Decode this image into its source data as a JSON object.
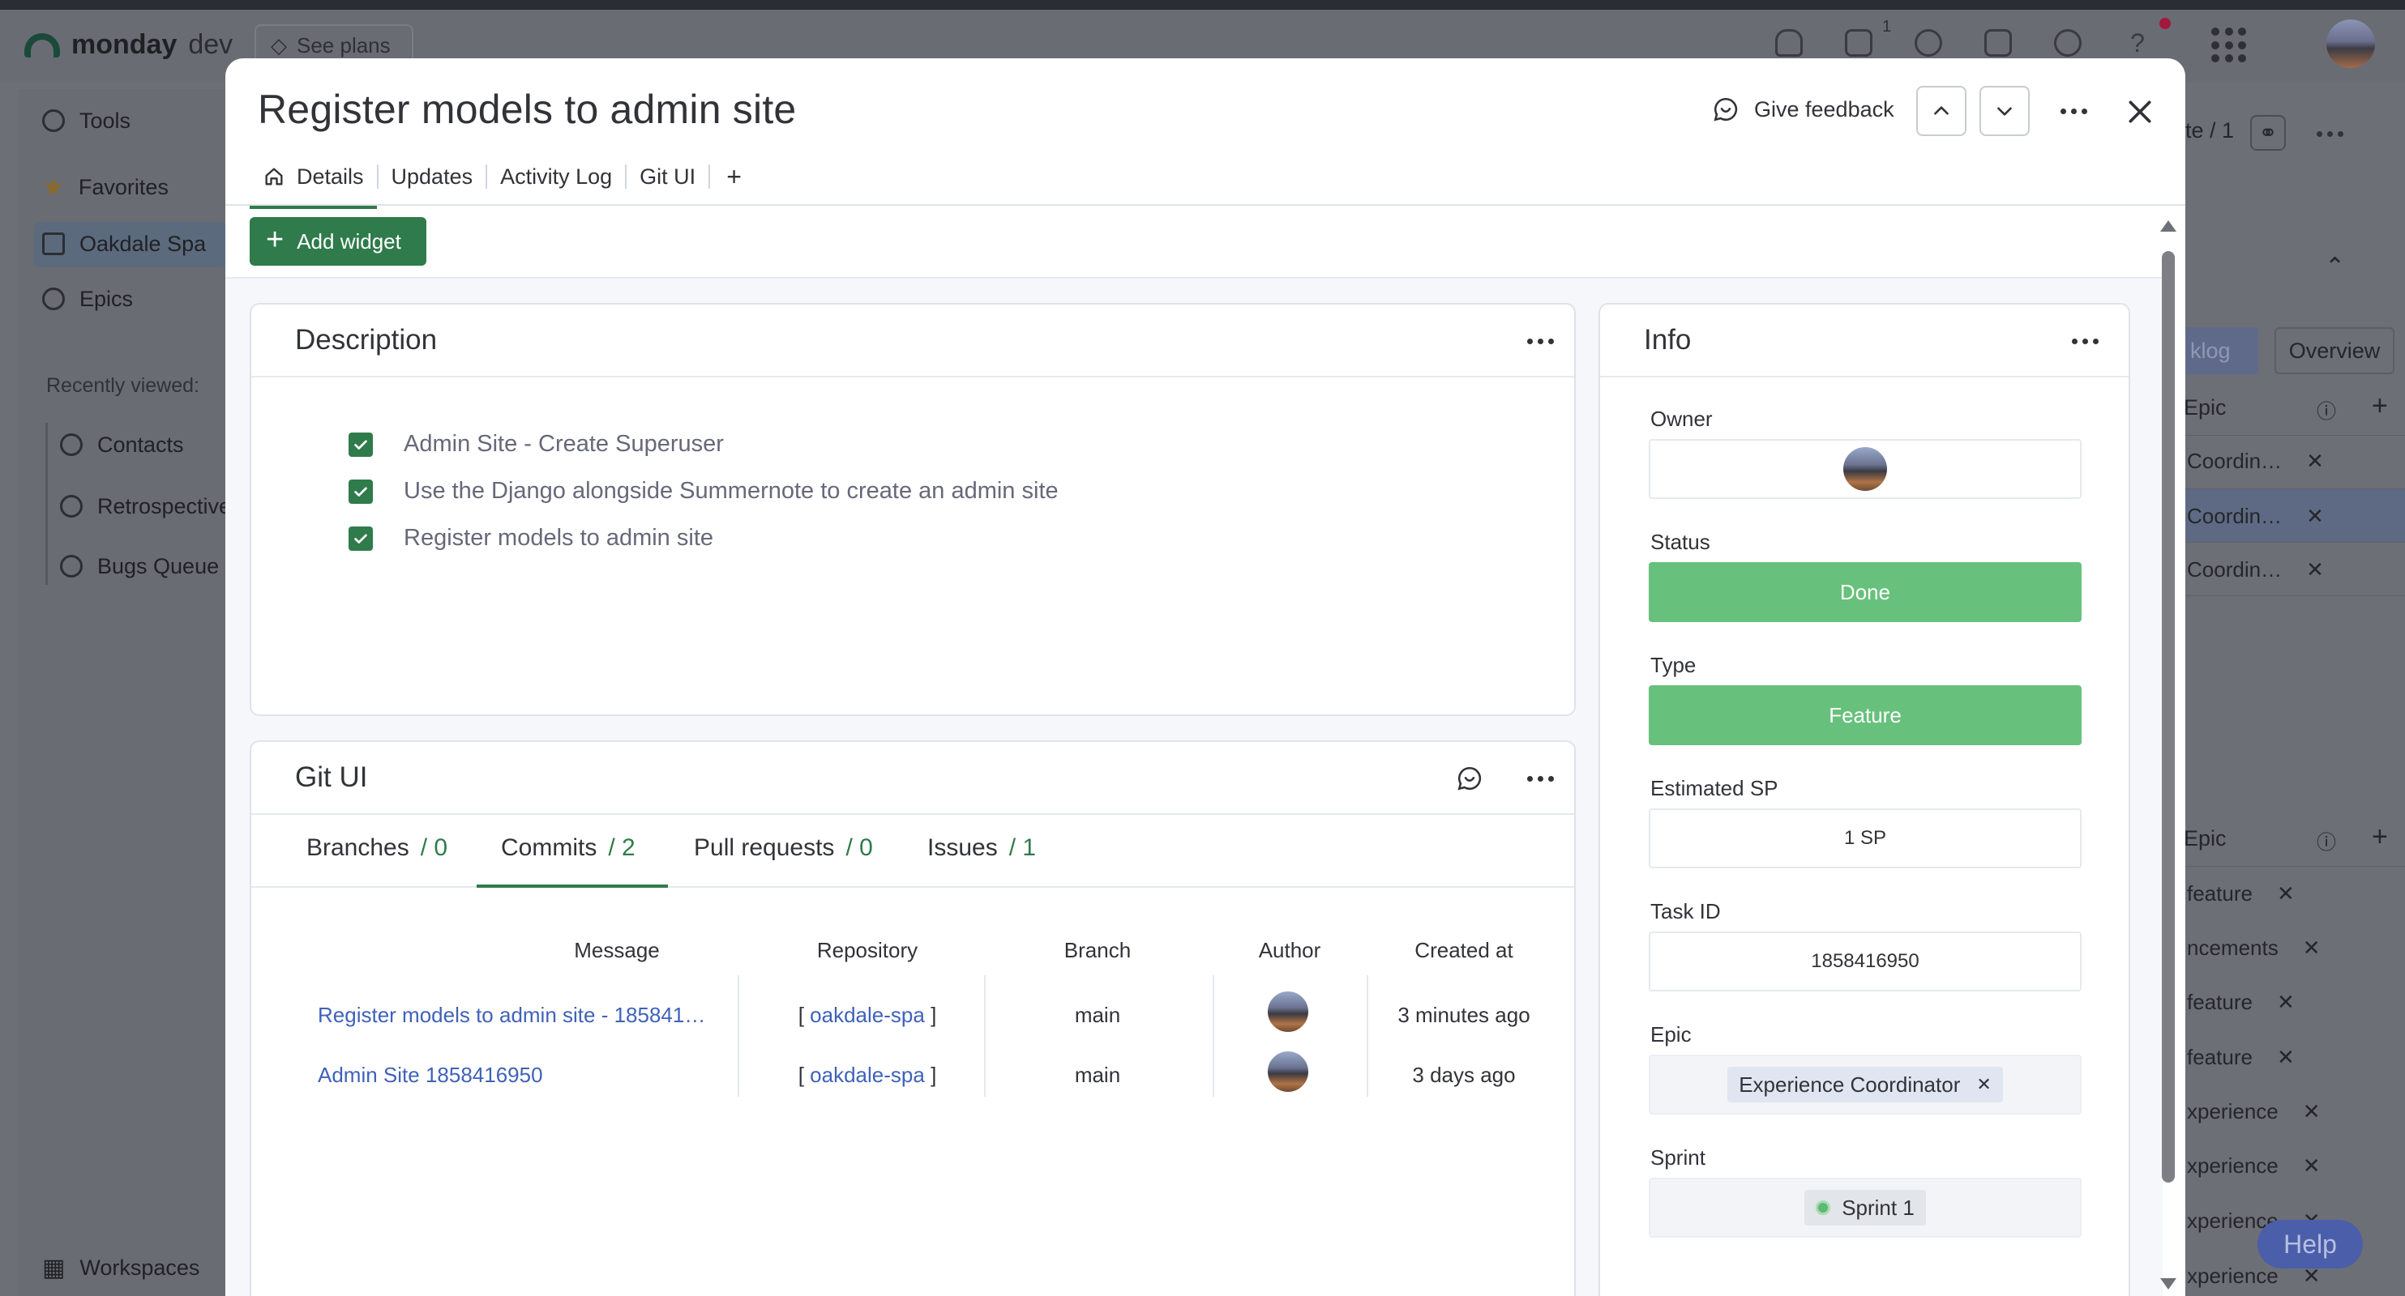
{
  "app": {
    "brand": "monday",
    "brand_suffix": "dev",
    "see_plans": "See plans",
    "inbox_badge": "1"
  },
  "sidebar": {
    "tools": "Tools",
    "favorites": "Favorites",
    "board": "Oakdale Spa",
    "epics": "Epics",
    "recently_viewed": "Recently viewed:",
    "recent": [
      "Contacts",
      "Retrospective",
      "Bugs Queue"
    ],
    "workspaces": "Workspaces"
  },
  "background_right": {
    "page_count": "te / 1",
    "overview": "Overview",
    "backlog_fragment": "klog",
    "epic_header": "Epic",
    "upper_chips": [
      "Coordin…",
      "Coordin…",
      "Coordin…"
    ],
    "lower_chips": [
      "feature",
      "ncements",
      "feature",
      "feature",
      "xperience",
      "xperience",
      "xperience",
      "xperience"
    ],
    "help": "Help"
  },
  "modal": {
    "title": "Register models to admin site",
    "give_feedback": "Give feedback",
    "tabs": [
      "Details",
      "Updates",
      "Activity Log",
      "Git UI"
    ],
    "add_tab": "+",
    "add_widget": "Add widget",
    "description": {
      "title": "Description",
      "items": [
        "Admin Site - Create Superuser",
        "Use the Django alongside Summernote to create an admin site",
        "Register models to admin site"
      ]
    },
    "git_ui": {
      "title": "Git UI",
      "tabs": [
        {
          "label": "Branches",
          "count": "/ 0"
        },
        {
          "label": "Commits",
          "count": "/ 2"
        },
        {
          "label": "Pull requests",
          "count": "/ 0"
        },
        {
          "label": "Issues",
          "count": "/ 1"
        }
      ],
      "columns": [
        "Message",
        "Repository",
        "Branch",
        "Author",
        "Created at"
      ],
      "rows": [
        {
          "message": "Register models to admin site - 185841…",
          "repo_open": "[",
          "repo": "oakdale-spa",
          "repo_close": "]",
          "branch": "main",
          "created": "3 minutes ago"
        },
        {
          "message": "Admin Site 1858416950",
          "repo_open": "[",
          "repo": "oakdale-spa",
          "repo_close": "]",
          "branch": "main",
          "created": "3 days ago"
        }
      ]
    },
    "info": {
      "title": "Info",
      "owner_label": "Owner",
      "status_label": "Status",
      "status_value": "Done",
      "type_label": "Type",
      "type_value": "Feature",
      "sp_label": "Estimated SP",
      "sp_value": "1 SP",
      "task_id_label": "Task ID",
      "task_id_value": "1858416950",
      "epic_label": "Epic",
      "epic_value": "Experience Coordinator",
      "sprint_label": "Sprint",
      "sprint_value": "Sprint 1"
    }
  },
  "colors": {
    "primary_green": "#2f7b4b",
    "status_green": "#67c17c",
    "link_blue": "#3f62b9"
  }
}
